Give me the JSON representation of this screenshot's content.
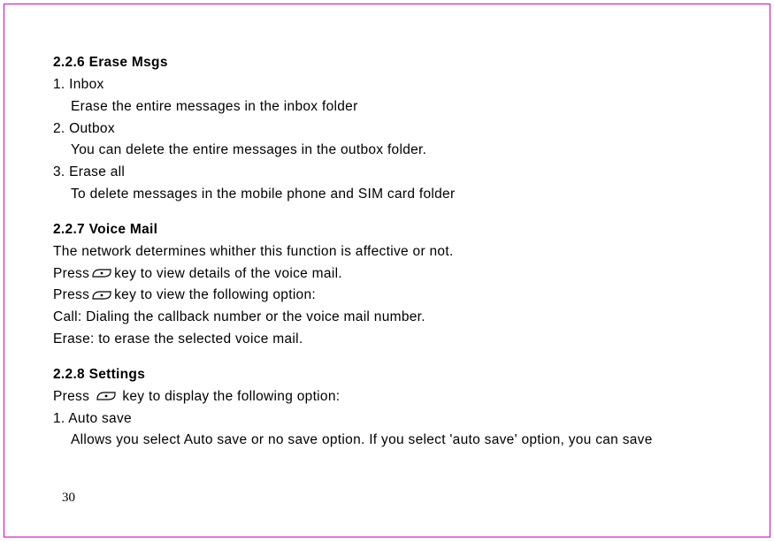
{
  "page_number": "30",
  "sections": {
    "erase_msgs": {
      "heading": "2.2.6 Erase Msgs",
      "item1_title": "1. Inbox",
      "item1_desc": "Erase the entire messages in the inbox folder",
      "item2_title": "2. Outbox",
      "item2_desc": "You can delete the entire messages in the outbox folder.",
      "item3_title": "3. Erase all",
      "item3_desc": "To delete messages in the mobile phone and SIM card folder"
    },
    "voice_mail": {
      "heading": "2.2.7 Voice Mail",
      "line1": "The network determines whither this function is affective or not.",
      "line2_pre": "Press",
      "line2_post": "key to view details of the voice mail.",
      "line3_pre": "Press",
      "line3_post": "key to view the following option:",
      "line4": "Call: Dialing the callback number or the voice mail number.",
      "line5": "Erase: to erase the selected voice mail."
    },
    "settings": {
      "heading": "2.2.8 Settings",
      "line1_pre": "Press ",
      "line1_post": " key to display the following option:",
      "item1_title": "1. Auto save",
      "item1_desc": "Allows you select Auto save or no save option. If you select 'auto save' option, you can save"
    }
  }
}
